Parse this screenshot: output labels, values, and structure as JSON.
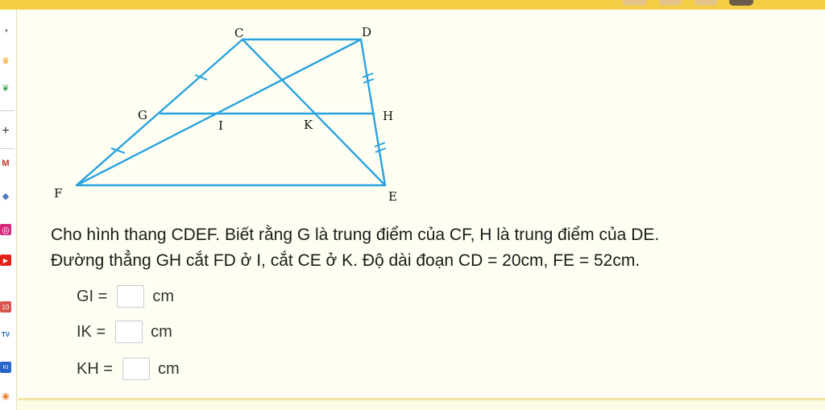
{
  "colors": {
    "topbar": "#f4ce45",
    "line": "#29a3e0",
    "page_bg": "#fffef2"
  },
  "sidebar": {
    "icons": [
      {
        "name": "clock-icon",
        "glyph": "◔"
      },
      {
        "name": "crown-icon",
        "glyph": "♛"
      },
      {
        "name": "leaf-icon",
        "glyph": "❦"
      },
      {
        "name": "plus-icon",
        "glyph": "+"
      },
      {
        "name": "gmail-icon",
        "glyph": "M"
      },
      {
        "name": "app-icon",
        "glyph": "◆"
      },
      {
        "name": "instagram-icon",
        "glyph": "◎"
      },
      {
        "name": "youtube-icon",
        "glyph": "▶"
      },
      {
        "name": "calendar-icon",
        "glyph": "10"
      },
      {
        "name": "tv-icon",
        "glyph": "TV"
      },
      {
        "name": "kid-icon",
        "glyph": "KI"
      },
      {
        "name": "maps-icon",
        "glyph": "◉"
      }
    ]
  },
  "figure": {
    "vertices": {
      "C": "C",
      "D": "D",
      "G": "G",
      "I": "I",
      "K": "K",
      "H": "H",
      "F": "F",
      "E": "E"
    }
  },
  "problem": {
    "line1": "Cho hình thang CDEF. Biết rằng G là trung điểm của CF, H là trung điểm của DE.",
    "line2": "Đường thẳng GH cắt FD ở I, cắt CE ở K. Độ dài đoạn CD = 20cm, FE = 52cm."
  },
  "answers": [
    {
      "label": "GI =",
      "unit": "cm"
    },
    {
      "label": "IK =",
      "unit": "cm"
    },
    {
      "label": "KH =",
      "unit": "cm"
    }
  ]
}
